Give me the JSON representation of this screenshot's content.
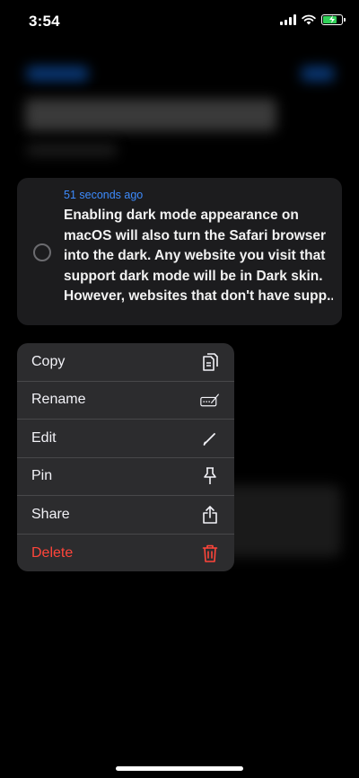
{
  "status_bar": {
    "time": "3:54"
  },
  "card": {
    "timestamp": "51 seconds ago",
    "lines": [
      "Enabling dark mode appearance on",
      "macOS will also turn the Safari browser",
      "into the dark. Any website you visit that",
      "support dark mode will be in Dark skin.",
      "However, websites that don't have supp..."
    ]
  },
  "menu": {
    "items": [
      {
        "label": "Copy",
        "icon": "copy-icon"
      },
      {
        "label": "Rename",
        "icon": "rename-icon"
      },
      {
        "label": "Edit",
        "icon": "pencil-icon"
      },
      {
        "label": "Pin",
        "icon": "pin-icon"
      },
      {
        "label": "Share",
        "icon": "share-icon"
      },
      {
        "label": "Delete",
        "icon": "trash-icon"
      }
    ]
  },
  "colors": {
    "accent": "#3d8bfd",
    "destructive": "#ff453a",
    "battery": "#30d158"
  }
}
